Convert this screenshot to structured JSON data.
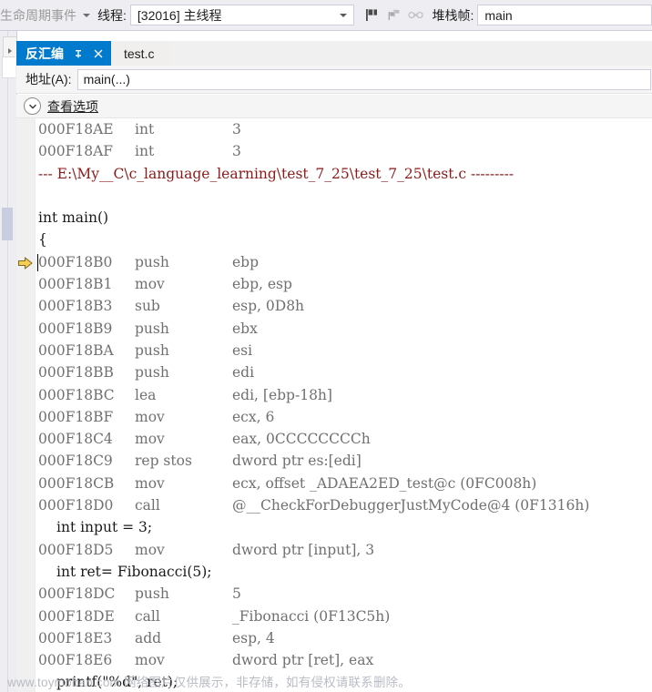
{
  "toolbar": {
    "lifecycle_label": "生命周期事件",
    "thread_label": "线程:",
    "thread_value": "[32016] 主线程",
    "frame_label": "堆栈帧:",
    "frame_value": "main",
    "icons": [
      "flag-icon",
      "flags-multiple-icon",
      "thread-link-icon"
    ]
  },
  "tabs": [
    {
      "label": "反汇编",
      "active": true,
      "pin": "pin-icon",
      "close": "close-icon"
    },
    {
      "label": "test.c",
      "active": false
    }
  ],
  "address_bar": {
    "label": "地址(A):",
    "value": "main(...)"
  },
  "view_options": {
    "label": "查看选项",
    "icon": "chevron-down-icon"
  },
  "code": {
    "lines": [
      {
        "kind": "asm",
        "addr": "000F18AE",
        "mnem": "int",
        "ops": "3"
      },
      {
        "kind": "asm",
        "addr": "000F18AF",
        "mnem": "int",
        "ops": "3"
      },
      {
        "kind": "path",
        "text": "--- E:\\My__C\\c_language_learning\\test_7_25\\test_7_25\\test.c ---------"
      },
      {
        "kind": "blank",
        "text": ""
      },
      {
        "kind": "src",
        "text": "int main()",
        "indent": false
      },
      {
        "kind": "src",
        "text": "{",
        "indent": false
      },
      {
        "kind": "asm",
        "addr": "000F18B0",
        "mnem": "push",
        "ops": "ebp",
        "current": true,
        "caret": true
      },
      {
        "kind": "asm",
        "addr": "000F18B1",
        "mnem": "mov",
        "ops": "ebp, esp"
      },
      {
        "kind": "asm",
        "addr": "000F18B3",
        "mnem": "sub",
        "ops": "esp, 0D8h"
      },
      {
        "kind": "asm",
        "addr": "000F18B9",
        "mnem": "push",
        "ops": "ebx"
      },
      {
        "kind": "asm",
        "addr": "000F18BA",
        "mnem": "push",
        "ops": "esi"
      },
      {
        "kind": "asm",
        "addr": "000F18BB",
        "mnem": "push",
        "ops": "edi"
      },
      {
        "kind": "asm",
        "addr": "000F18BC",
        "mnem": "lea",
        "ops": "edi, [ebp-18h]"
      },
      {
        "kind": "asm",
        "addr": "000F18BF",
        "mnem": "mov",
        "ops": "ecx, 6"
      },
      {
        "kind": "asm",
        "addr": "000F18C4",
        "mnem": "mov",
        "ops": "eax, 0CCCCCCCCh"
      },
      {
        "kind": "asm",
        "addr": "000F18C9",
        "mnem": "rep stos",
        "ops": "dword ptr es:[edi]"
      },
      {
        "kind": "asm",
        "addr": "000F18CB",
        "mnem": "mov",
        "ops": "ecx, offset _ADAEA2ED_test@c (0FC008h)"
      },
      {
        "kind": "asm",
        "addr": "000F18D0",
        "mnem": "call",
        "ops": "@__CheckForDebuggerJustMyCode@4 (0F1316h)"
      },
      {
        "kind": "src",
        "text": "int input = 3;",
        "indent": true
      },
      {
        "kind": "asm",
        "addr": "000F18D5",
        "mnem": "mov",
        "ops": "dword ptr [input], 3"
      },
      {
        "kind": "src",
        "text": "int ret= Fibonacci(5);",
        "indent": true
      },
      {
        "kind": "asm",
        "addr": "000F18DC",
        "mnem": "push",
        "ops": "5"
      },
      {
        "kind": "asm",
        "addr": "000F18DE",
        "mnem": "call",
        "ops": "_Fibonacci (0F13C5h)"
      },
      {
        "kind": "asm",
        "addr": "000F18E3",
        "mnem": "add",
        "ops": "esp, 4"
      },
      {
        "kind": "asm",
        "addr": "000F18E6",
        "mnem": "mov",
        "ops": "dword ptr [ret], eax"
      },
      {
        "kind": "src",
        "text": "printf(\"%d\", ret);",
        "indent": true
      }
    ]
  },
  "watermark": {
    "text": "www.toymoban.com 网络图片仅供展示，非存储，如有侵权请联系删除。"
  },
  "colors": {
    "accent": "#007acc",
    "toolbar_bg": "#eeeef2",
    "asm_text": "#707070",
    "src_text": "#1a1a1a",
    "path_text": "#8b1a1a",
    "ip_arrow": "#f0c419"
  }
}
